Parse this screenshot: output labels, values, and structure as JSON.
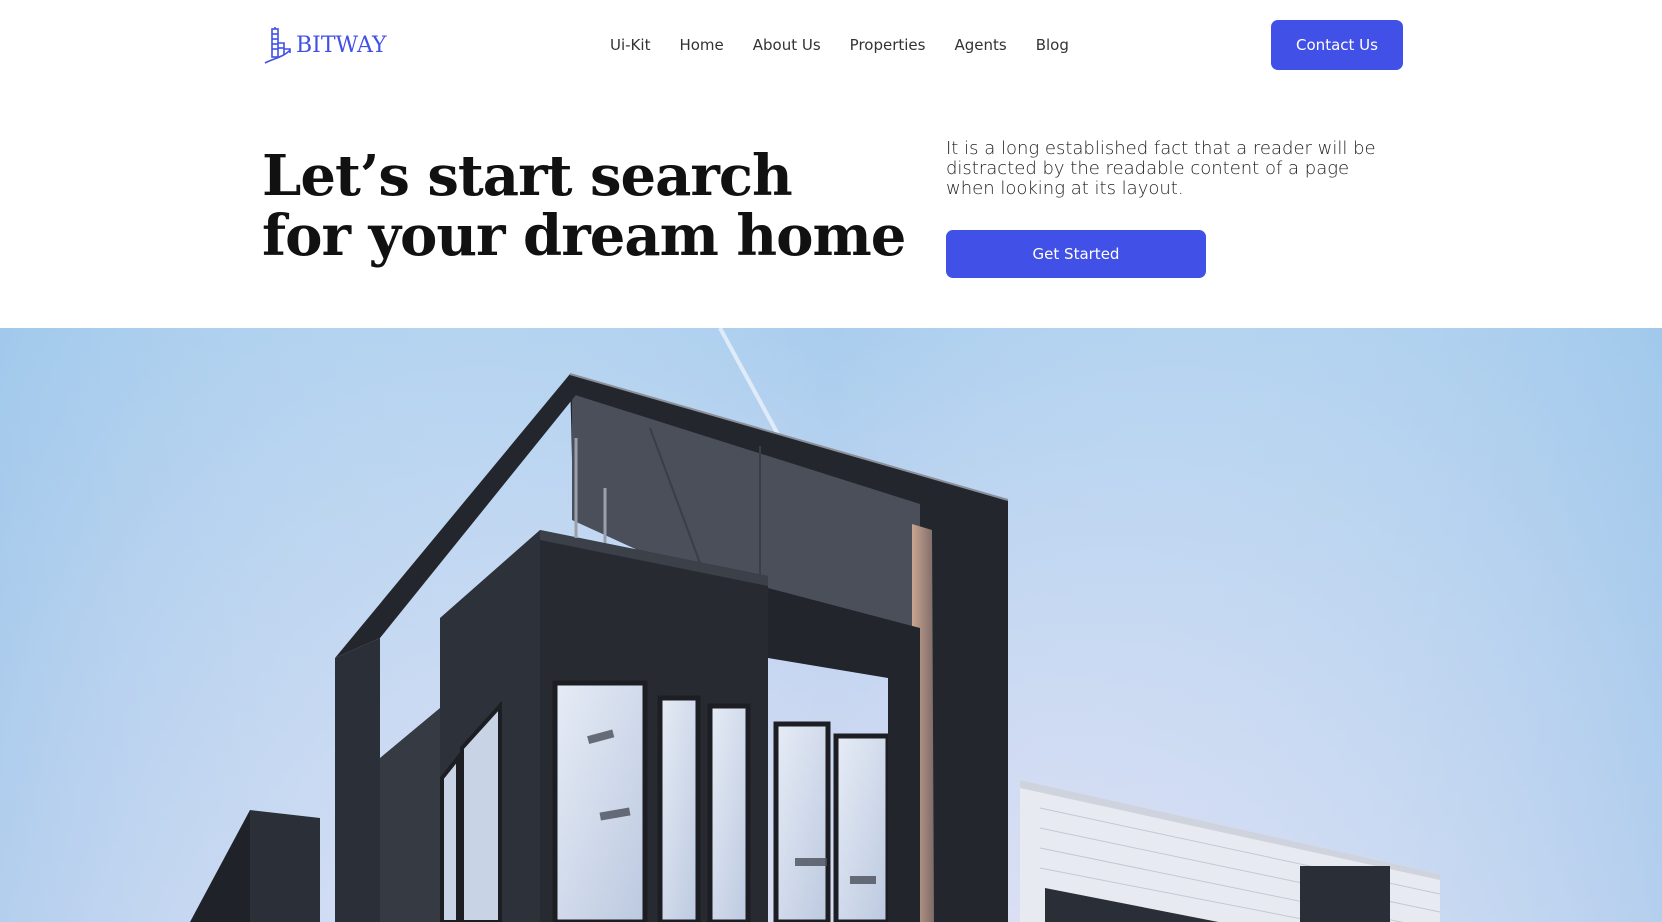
{
  "brand": {
    "name": "BITWAY",
    "logo_icon": "building-icon",
    "accent_color": "#4150e6"
  },
  "nav": {
    "items": [
      {
        "label": "Ui-Kit"
      },
      {
        "label": "Home"
      },
      {
        "label": "About Us"
      },
      {
        "label": "Properties"
      },
      {
        "label": "Agents"
      },
      {
        "label": "Blog"
      }
    ]
  },
  "header": {
    "contact_label": "Contact Us"
  },
  "hero": {
    "title_line1": "Let’s start search",
    "title_line2": "for your dream home",
    "description": "It is a long established fact that a reader will be distracted by the readable content of a page when looking at its layout.",
    "cta_label": "Get Started"
  },
  "colors": {
    "primary_button": "#4150e6",
    "text_dark": "#111111",
    "sky_top": "#a9cdee",
    "sky_bottom": "#d4dcf2",
    "building_dark": "#23262d"
  }
}
